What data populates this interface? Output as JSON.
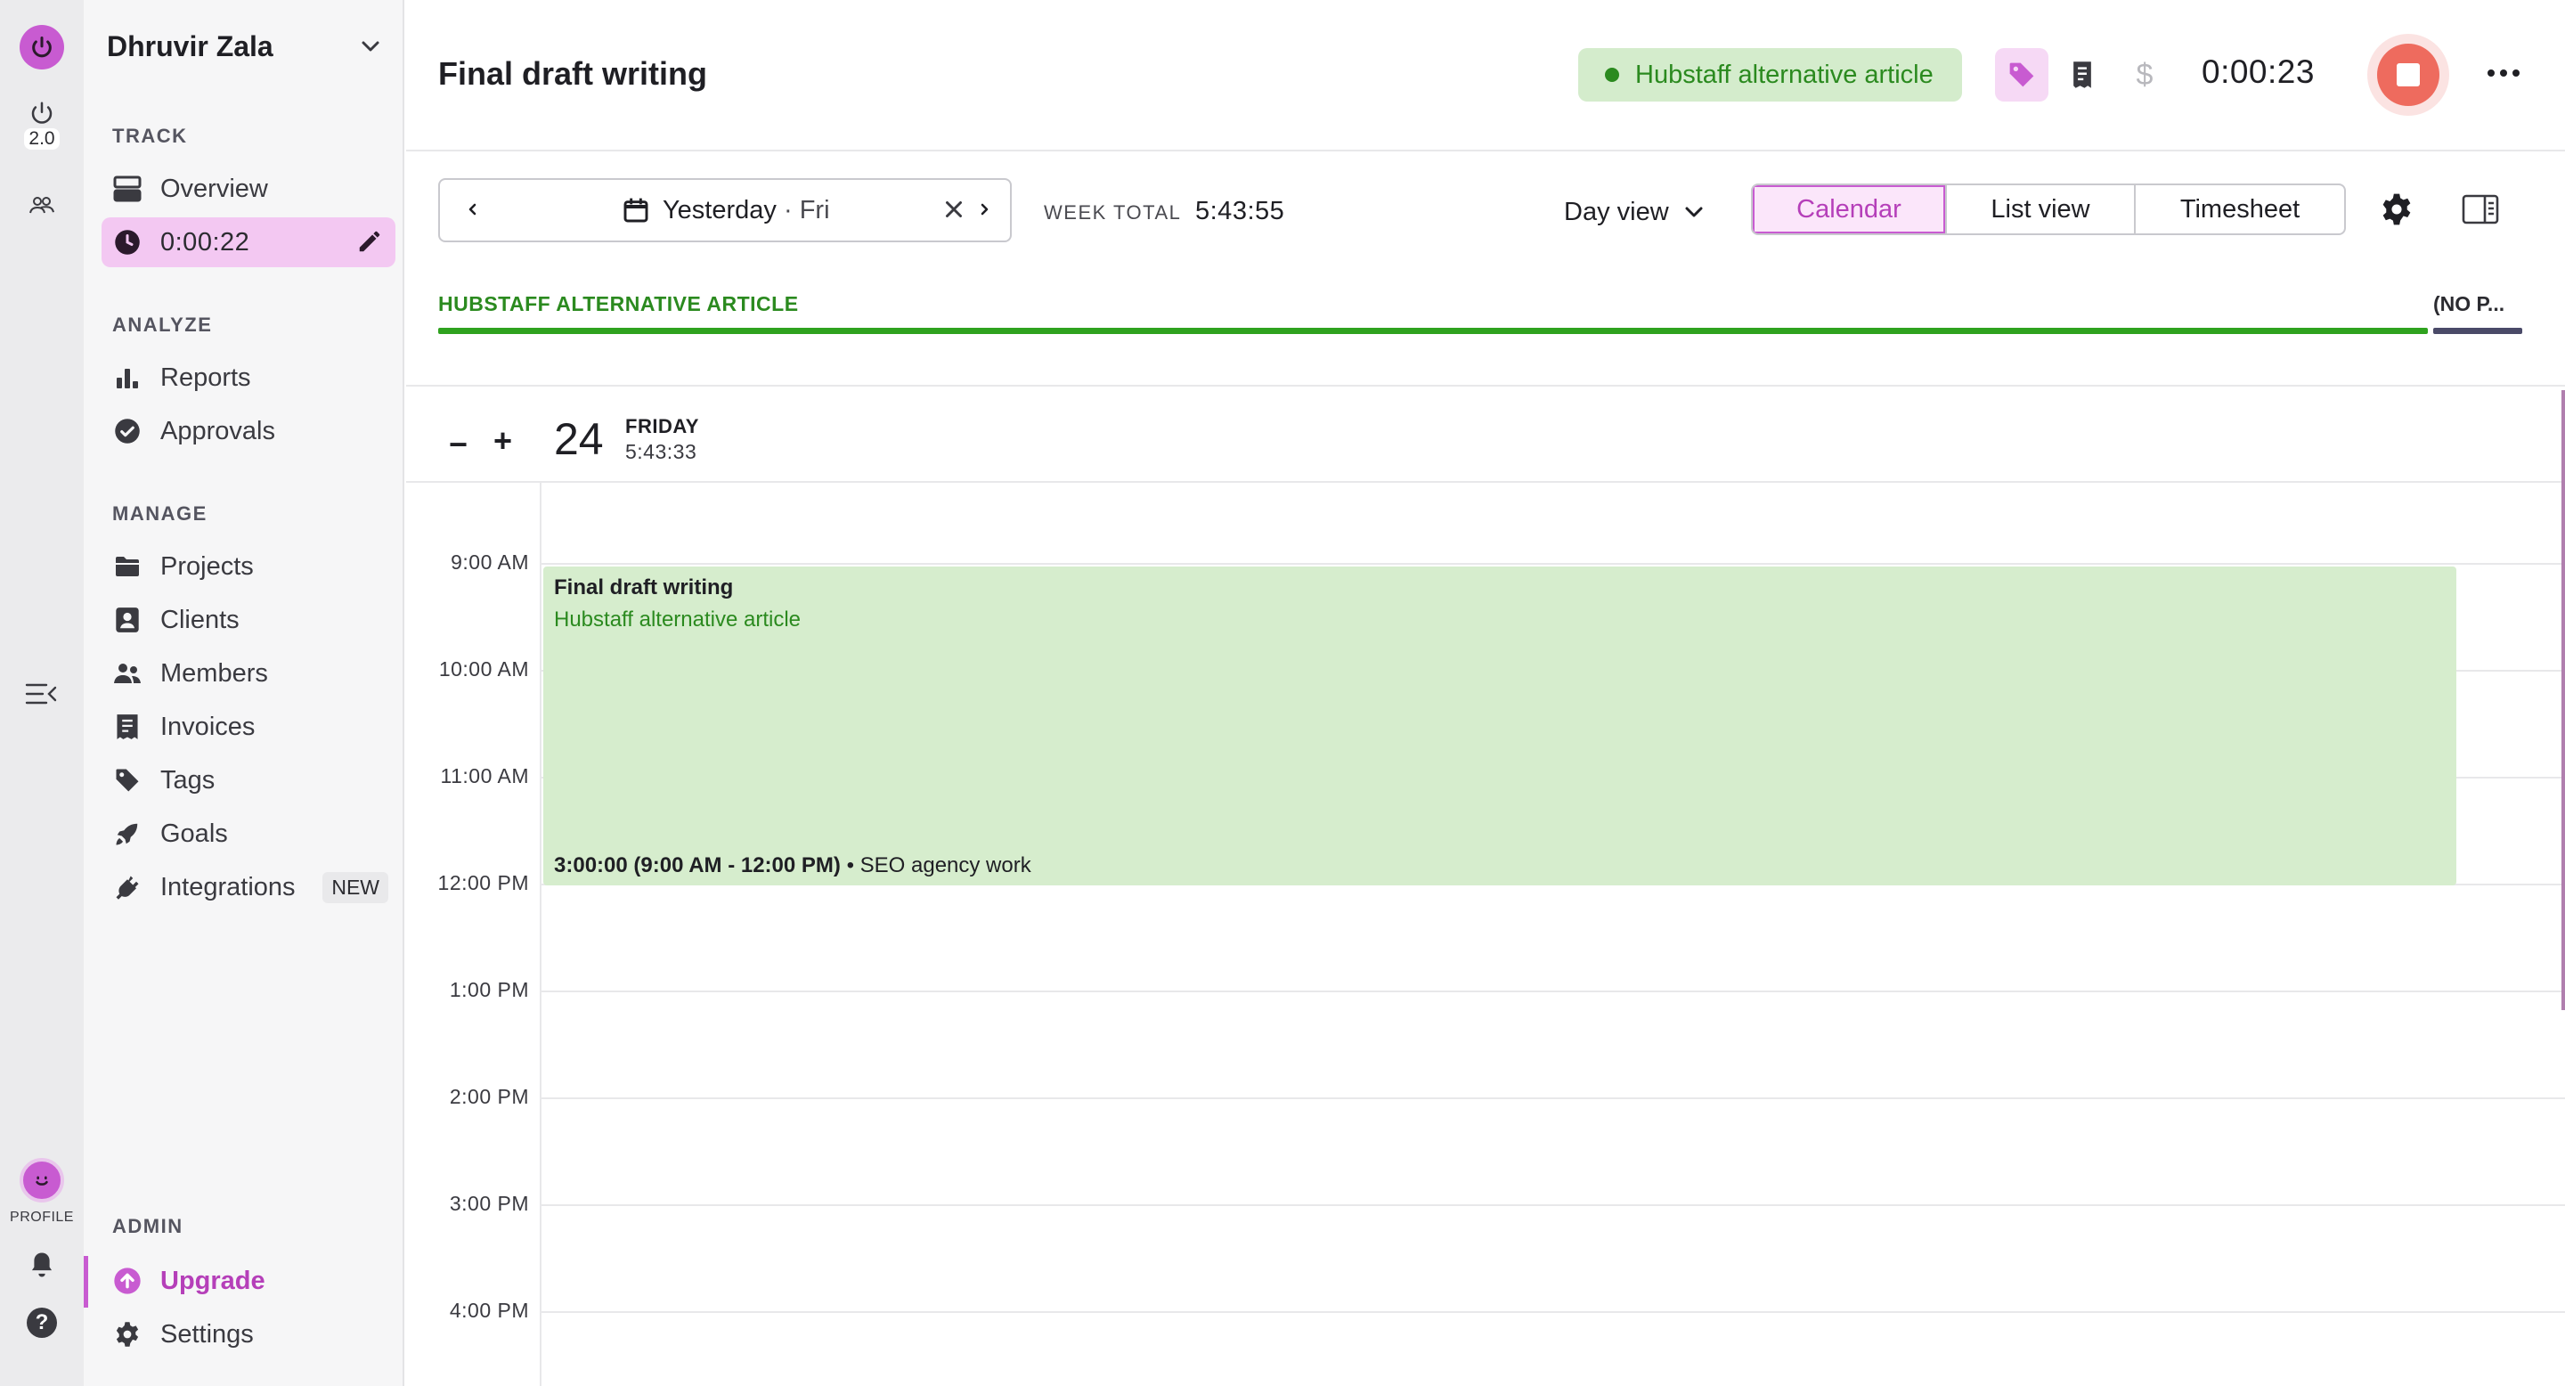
{
  "sidebar": {
    "user_name": "Dhruvir Zala",
    "sections": {
      "track": "TRACK",
      "analyze": "ANALYZE",
      "manage": "MANAGE",
      "admin": "ADMIN"
    },
    "track_items": {
      "overview": "Overview",
      "timer": "0:00:22"
    },
    "analyze_items": {
      "reports": "Reports",
      "approvals": "Approvals"
    },
    "manage_items": {
      "projects": "Projects",
      "clients": "Clients",
      "members": "Members",
      "invoices": "Invoices",
      "tags": "Tags",
      "goals": "Goals",
      "integrations": "Integrations",
      "integrations_badge": "NEW"
    },
    "admin_items": {
      "upgrade": "Upgrade",
      "settings": "Settings"
    }
  },
  "rail": {
    "version_label": "2.0",
    "profile_label": "PROFILE"
  },
  "header": {
    "task_title": "Final draft writing",
    "project_name": "Hubstaff alternative article",
    "project_color": "#2b8a1f",
    "dollar_symbol": "$",
    "timer": "0:00:23"
  },
  "toolbar": {
    "date_label": "Yesterday",
    "date_separator": "·",
    "date_day": "Fri",
    "week_total_label": "WEEK TOTAL",
    "week_total_value": "5:43:55",
    "view_selector": "Day view",
    "tabs": {
      "calendar": "Calendar",
      "list": "List view",
      "timesheet": "Timesheet"
    },
    "active_tab": "calendar",
    "accent_color": "#c85bd1"
  },
  "project_summary": {
    "primary_label": "HUBSTAFF ALTERNATIVE ARTICLE",
    "secondary_label": "(NO P..."
  },
  "day": {
    "number": "24",
    "weekday": "FRIDAY",
    "total": "5:43:33",
    "zoom_out": "−",
    "zoom_in": "+"
  },
  "calendar": {
    "hours": [
      "9:00 AM",
      "10:00 AM",
      "11:00 AM",
      "12:00 PM",
      "1:00 PM",
      "2:00 PM",
      "3:00 PM",
      "4:00 PM"
    ],
    "event": {
      "title": "Final draft writing",
      "project": "Hubstaff alternative article",
      "duration": "3:00:00 (9:00 AM - 12:00 PM)",
      "separator": "•",
      "tag": "SEO agency work",
      "color": "#d6edcd"
    }
  }
}
